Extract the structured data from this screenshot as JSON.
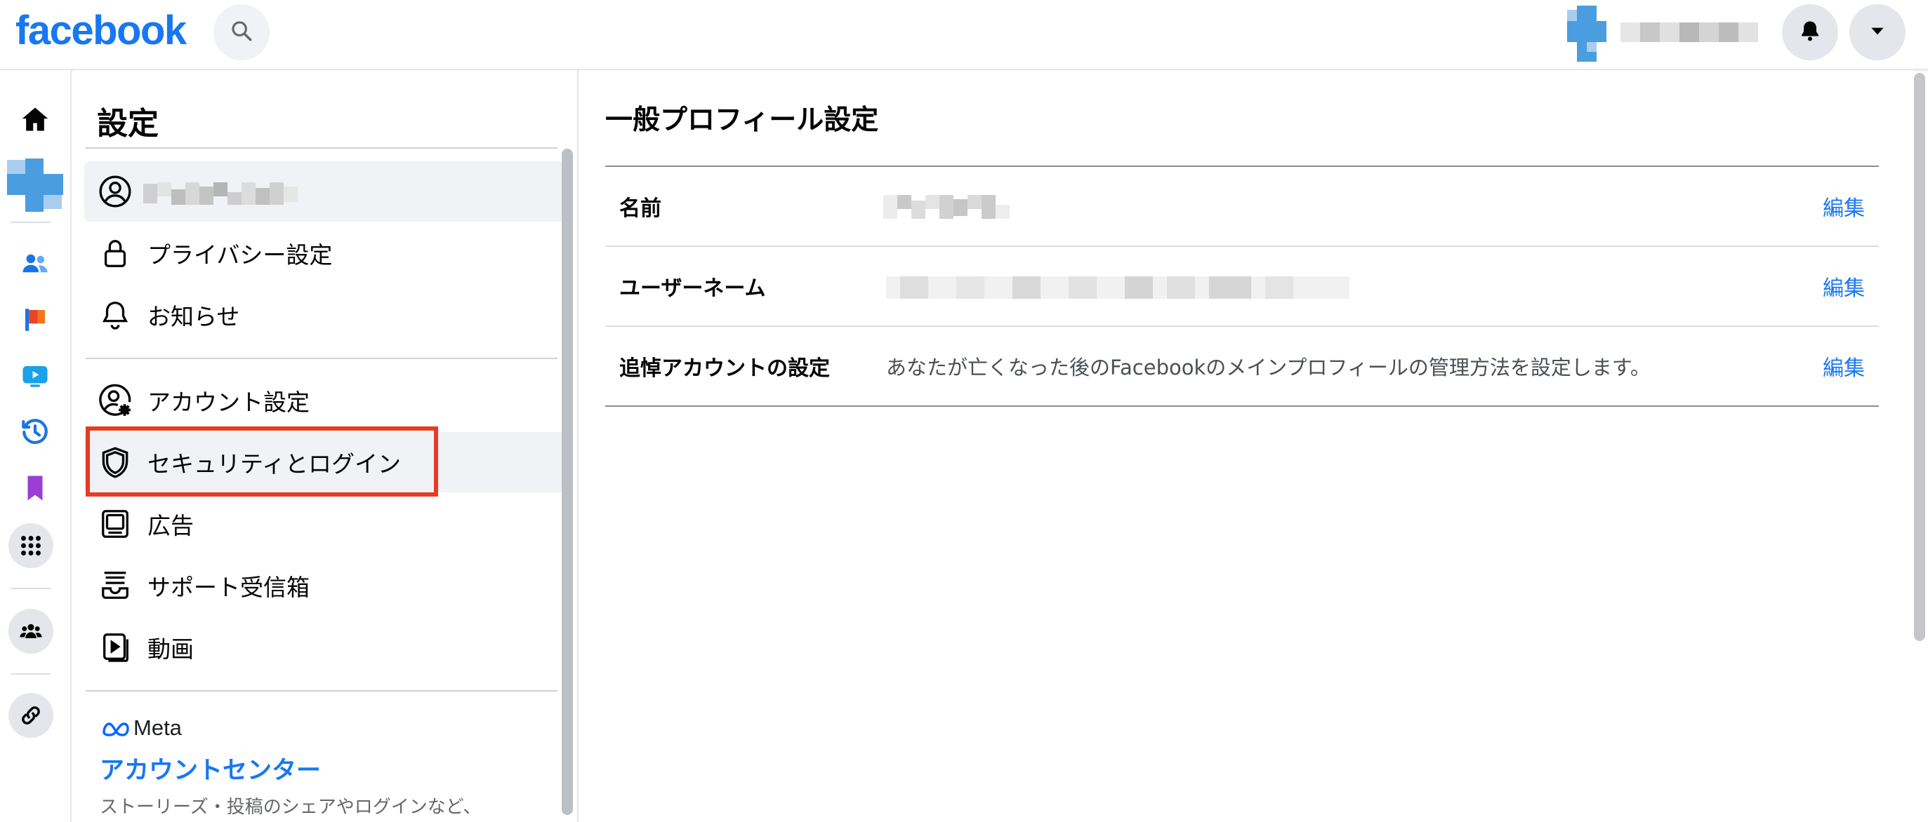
{
  "topbar": {
    "logo_text": "facebook",
    "search_icon": "search-icon",
    "notifications_icon": "bell-icon",
    "account_menu_icon": "caret-down-icon"
  },
  "rail": {
    "items": [
      "home-icon",
      "profile-avatar",
      "friends-icon",
      "pages-icon",
      "watch-icon",
      "memories-icon",
      "saved-icon",
      "menu-grid-icon",
      "groups-icon",
      "link-icon"
    ]
  },
  "settings": {
    "title": "設定",
    "items": [
      {
        "label": "",
        "icon": "user-circle-icon"
      },
      {
        "label": "プライバシー設定",
        "icon": "lock-icon"
      },
      {
        "label": "お知らせ",
        "icon": "bell-outline-icon"
      },
      {
        "label": "アカウント設定",
        "icon": "account-gear-icon"
      },
      {
        "label": "セキュリティとログイン",
        "icon": "shield-icon"
      },
      {
        "label": "広告",
        "icon": "ads-icon"
      },
      {
        "label": "サポート受信箱",
        "icon": "inbox-icon"
      },
      {
        "label": "動画",
        "icon": "video-icon"
      }
    ],
    "meta_label": "Meta",
    "account_center": "アカウントセンター",
    "account_center_desc": "ストーリーズ・投稿のシェアやログインなど、"
  },
  "main": {
    "title": "一般プロフィール設定",
    "rows": [
      {
        "label": "名前",
        "value": "",
        "edit": "編集"
      },
      {
        "label": "ユーザーネーム",
        "value": "",
        "edit": "編集"
      },
      {
        "label": "追悼アカウントの設定",
        "value": "あなたが亡くなった後のFacebookのメインプロフィールの管理方法を設定します。",
        "edit": "編集"
      }
    ]
  },
  "colors": {
    "brand": "#1877f2",
    "highlight": "#e53c25"
  }
}
